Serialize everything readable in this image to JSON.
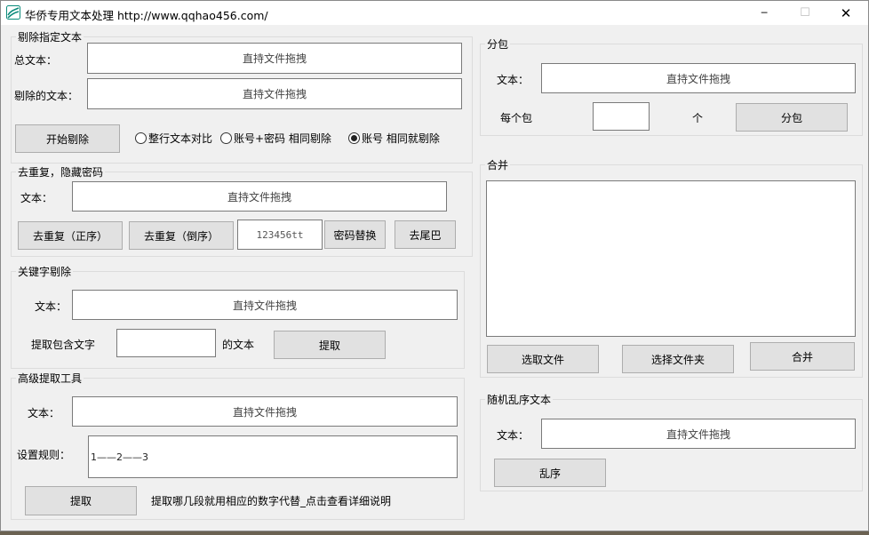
{
  "window": {
    "title": "华侨专用文本处理 http://www.qqhao456.com/",
    "minimize_glyph": "─",
    "maximize_glyph": "☐",
    "close_glyph": "✕"
  },
  "drop_placeholder": "直持文件拖拽",
  "remove_text": {
    "group_label": "剔除指定文本",
    "total_label": "总文本：",
    "total_value": "直持文件拖拽",
    "removed_label": "剔除的文本：",
    "removed_value": "直持文件拖拽",
    "start_button": "开始剔除",
    "options": [
      {
        "label": "整行文本对比",
        "selected": false
      },
      {
        "label": "账号+密码  相同剔除",
        "selected": false
      },
      {
        "label": "账号  相同就剔除",
        "selected": true
      }
    ]
  },
  "dedupe": {
    "group_label": "去重复，隐藏密码",
    "text_label": "文本：",
    "text_value": "直持文件拖拽",
    "asc_button": "去重复（正序）",
    "desc_button": "去重复（倒序）",
    "password_value": "123456tt",
    "replace_button": "密码替换",
    "tail_button": "去尾巴"
  },
  "keyword": {
    "group_label": "关键字剔除",
    "text_label": "文本：",
    "text_value": "直持文件拖拽",
    "contains_label": "提取包含文字",
    "contains_value": "",
    "suffix_label": "的文本",
    "extract_button": "提取"
  },
  "advanced": {
    "group_label": "高级提取工具",
    "text_label": "文本：",
    "text_value": "直持文件拖拽",
    "rule_label": "设置规则：",
    "rule_value": "1——2——3",
    "extract_button": "提取",
    "hint": "提取哪几段就用相应的数字代替_点击查看详细说明"
  },
  "split": {
    "group_label": "分包",
    "text_label": "文本：",
    "text_value": "直持文件拖拽",
    "per_label": "每个包",
    "per_value": "",
    "unit_label": "个",
    "split_button": "分包"
  },
  "merge": {
    "group_label": "合并",
    "list_value": "",
    "select_file_button": "选取文件",
    "select_folder_button": "选择文件夹",
    "merge_button": "合并"
  },
  "shuffle": {
    "group_label": "随机乱序文本",
    "text_label": "文本：",
    "text_value": "直持文件拖拽",
    "shuffle_button": "乱序"
  }
}
